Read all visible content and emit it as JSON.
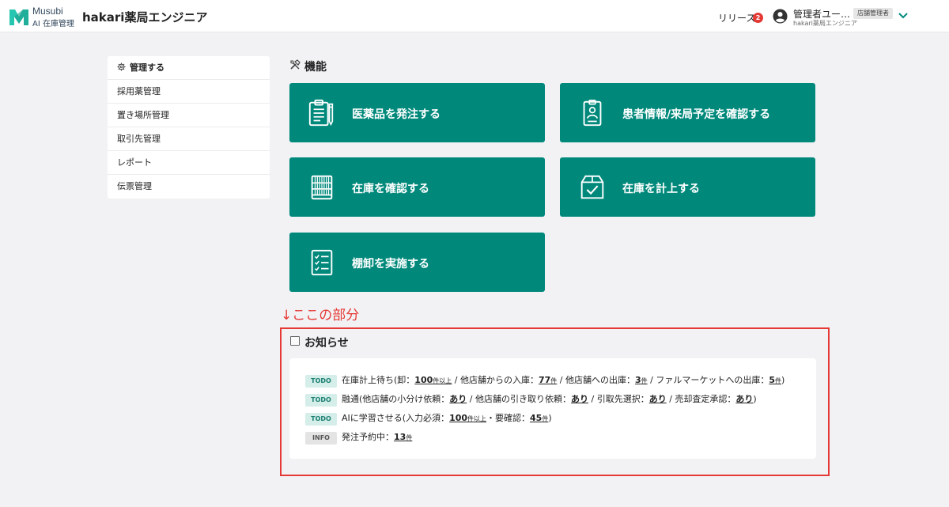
{
  "header": {
    "logo_line1": "Musubi",
    "logo_line2": "AI 在庫管理",
    "app_title": "hakari薬局エンジニア",
    "release_label": "リリース",
    "release_count": "2",
    "user_name": "管理者ユー…",
    "user_store": "hakari薬局エンジニア",
    "role_badge": "店舗管理者",
    "accent_color": "#00897b"
  },
  "sidebar": {
    "title": "管理する",
    "items": [
      {
        "label": "採用薬管理"
      },
      {
        "label": "置き場所管理"
      },
      {
        "label": "取引先管理"
      },
      {
        "label": "レポート"
      },
      {
        "label": "伝票管理"
      }
    ]
  },
  "features": {
    "title": "機能",
    "buttons": [
      {
        "label": "医薬品を発注する",
        "icon": "clipboard-pen-icon"
      },
      {
        "label": "患者情報/来局予定を確認する",
        "icon": "patient-badge-icon"
      },
      {
        "label": "在庫を確認する",
        "icon": "shelf-icon"
      },
      {
        "label": "在庫を計上する",
        "icon": "box-check-icon"
      },
      {
        "label": "棚卸を実施する",
        "icon": "checklist-icon"
      }
    ]
  },
  "annotation": "↓ここの部分",
  "notices": {
    "title": "お知らせ",
    "rows": [
      {
        "tag": "TODO",
        "p1": "在庫計上待ち(卸：",
        "v1": "100",
        "u1": "件以上",
        "p2": " / 他店舗からの入庫：",
        "v2": "77",
        "u2": "件",
        "p3": " / 他店舗への出庫：",
        "v3": "3",
        "u3": "件",
        "p4": " / ファルマーケットへの出庫：",
        "v4": "5",
        "u4": "件",
        "end": ")"
      },
      {
        "tag": "TODO",
        "p1": "融通(他店舗の小分け依頼：",
        "v1": "あり",
        "p2": " / 他店舗の引き取り依頼：",
        "v2": "あり",
        "p3": " / 引取先選択：",
        "v3": "あり",
        "p4": " / 売却査定承認：",
        "v4": "あり",
        "end": ")"
      },
      {
        "tag": "TODO",
        "p1": "AIに学習させる(入力必須：",
        "v1": "100",
        "u1": "件以上",
        "p2": "・要確認：",
        "v2": "45",
        "u2": "件",
        "end": ")"
      },
      {
        "tag": "INFO",
        "p1": "発注予約中：",
        "v1": "13",
        "u1": "件"
      }
    ]
  }
}
